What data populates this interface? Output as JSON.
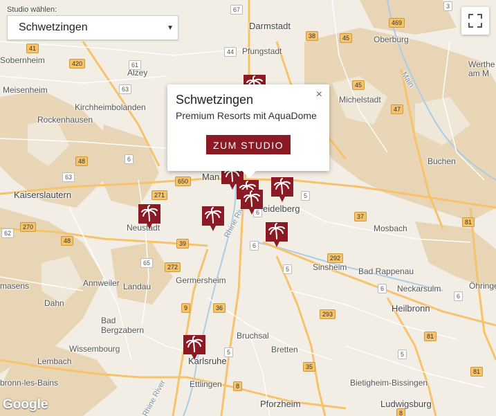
{
  "selector": {
    "caption": "Studio wählen:",
    "selected": "Schwetzingen"
  },
  "popup": {
    "title": "Schwetzingen",
    "subtitle": "Premium Resorts mit AquaDome",
    "button_label": "ZUM STUDIO",
    "close_label": "×"
  },
  "colors": {
    "brand": "#8b1a24",
    "road": "#f6c36b",
    "land": "#f4efe6",
    "forest": "#e6d3b3"
  },
  "icons": {
    "fullscreen": "fullscreen-icon",
    "marker": "palm-marker-icon"
  },
  "attribution": "Google",
  "places": {
    "darmstadt": "Darmstadt",
    "pfungstadt": "Pfungstadt",
    "oberburg": "Oberburg",
    "wertheim": "Werthe am M",
    "sobernheim": "Sobernheim",
    "alzey": "Alzey",
    "meisenheim": "Meisenheim",
    "kirchheimbolanden": "Kirchheimbolanden",
    "rockenhausen": "Rockenhausen",
    "michelstadt": "Michelstadt",
    "main": "Main",
    "buchen": "Buchen",
    "kaiserslautern": "Kaiserslautern",
    "mannheim": "Man",
    "heidelberg": "eidelberg",
    "neustadt": "Neustadt",
    "mosbach": "Mosbach",
    "rhine": "Rhine River",
    "sinsheim": "Sinsheim",
    "bad_rappenau": "Bad Rappenau",
    "annweiler": "Annweiler",
    "landau": "Landau",
    "germersheim": "Germersheim",
    "neckarsulm": "Neckarsulm",
    "oehringen": "Öhringe",
    "masens": "masens",
    "dahn": "Dahn",
    "heilbronn": "Heilbronn",
    "bruchsal": "Bruchsal",
    "bad_bergzabern": "Bad\nBergzabern",
    "wissembourg": "Wissembourg",
    "bretten": "Bretten",
    "lembach": "Lembach",
    "karlsruhe": "Karlsruhe",
    "bronn": "bronn-les-Bains",
    "ettlingen": "Ettlingen",
    "bietigheim": "Bietigheim-Bissingen",
    "pforzheim": "Pforzheim",
    "ludwigsburg": "Ludwigsburg",
    "rhine2": "Rhine River"
  },
  "shields": [
    "67",
    "3",
    "469",
    "38",
    "45",
    "41",
    "420",
    "61",
    "63",
    "44",
    "47",
    "45",
    "48",
    "6",
    "63",
    "271",
    "650",
    "270",
    "48",
    "39",
    "65",
    "272",
    "62",
    "6",
    "292",
    "5",
    "37",
    "81",
    "5",
    "6",
    "9",
    "36",
    "6",
    "293",
    "35",
    "5",
    "8",
    "81",
    "5",
    "8",
    "81",
    "6"
  ]
}
